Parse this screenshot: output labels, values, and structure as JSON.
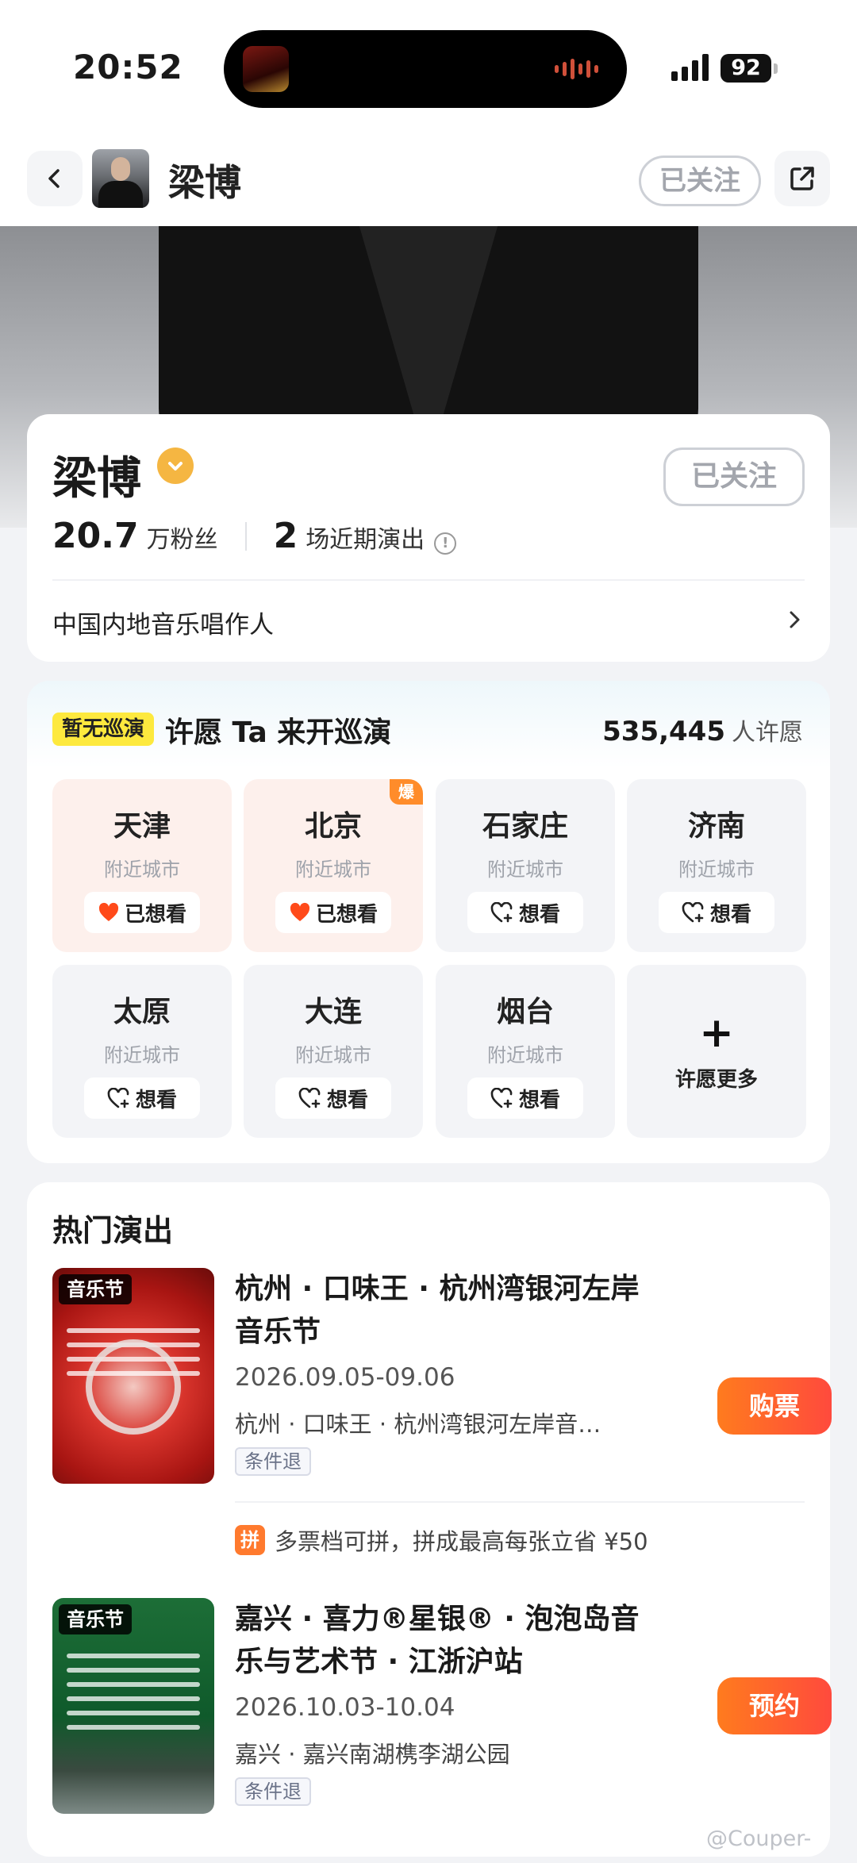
{
  "status_bar": {
    "time": "20:52",
    "battery": "92"
  },
  "nav": {
    "title": "梁博",
    "follow_label": "已关注"
  },
  "profile": {
    "name": "梁博",
    "follow_label": "已关注",
    "fans_num": "20.7",
    "fans_unit": "万粉丝",
    "shows_num": "2",
    "shows_unit": "场近期演出",
    "bio": "中国内地音乐唱作人"
  },
  "tour": {
    "tag": "暂无巡演",
    "title": "许愿 Ta 来开巡演",
    "count": "535,445",
    "count_label": "人许愿",
    "nearby": "附近城市",
    "cities": [
      {
        "name": "天津",
        "action": "已想看",
        "wanted": true
      },
      {
        "name": "北京",
        "action": "已想看",
        "wanted": true,
        "flame": "爆"
      },
      {
        "name": "石家庄",
        "action": "想看",
        "wanted": false
      },
      {
        "name": "济南",
        "action": "想看",
        "wanted": false
      },
      {
        "name": "太原",
        "action": "想看",
        "wanted": false
      },
      {
        "name": "大连",
        "action": "想看",
        "wanted": false
      },
      {
        "name": "烟台",
        "action": "想看",
        "wanted": false
      }
    ],
    "more_label": "许愿更多"
  },
  "shows": {
    "heading": "热门演出",
    "items": [
      {
        "poster_tag": "音乐节",
        "title": "杭州 · 口味王 · 杭州湾银河左岸音乐节",
        "date": "2026.09.05-09.06",
        "venue": "杭州 · 口味王 · 杭州湾银河左岸音…",
        "refund": "条件退",
        "button": "购票"
      },
      {
        "poster_tag": "音乐节",
        "title": "嘉兴 · 喜力®星银® · 泡泡岛音乐与艺术节 · 江浙沪站",
        "date": "2026.10.03-10.04",
        "venue": "嘉兴 · 嘉兴南湖槜李湖公园",
        "refund": "条件退",
        "button": "预约"
      }
    ],
    "promo_badge": "拼",
    "promo_text": "多票档可拼，拼成最高每张立省 ¥50"
  },
  "watermark": "@Couper-",
  "colors": {
    "accent": "#ff5a36",
    "tag_yellow": "#fde93e",
    "verified": "#f5b642"
  }
}
